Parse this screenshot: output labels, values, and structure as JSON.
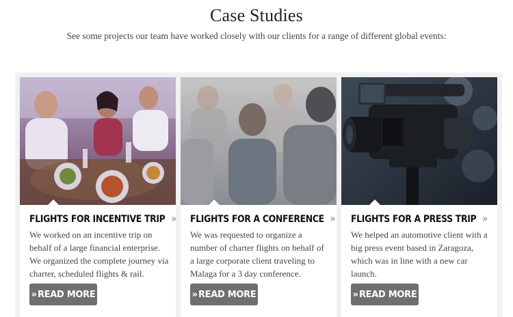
{
  "header": {
    "title": "Case Studies",
    "subtitle": "See some projects our team have worked closely with our clients for a range of different global events:"
  },
  "cards": [
    {
      "image_icon": "dinner-party-photo",
      "title": "FLIGHTS FOR INCENTIVE TRIP",
      "chevron": "»",
      "text": "We worked on an incentive trip on behalf of a large financial enterprise. We organized the complete journey via charter, scheduled flights & rail.",
      "button_icon": "»",
      "button_label": "READ MORE"
    },
    {
      "image_icon": "conference-audience-photo",
      "title": "FLIGHTS FOR A CONFERENCE",
      "chevron": "»",
      "text": "We was requested to organize a number of charter flights on behalf of a large corporate client traveling to Malaga for a 3 day conference.",
      "button_icon": "»",
      "button_label": "READ MORE"
    },
    {
      "image_icon": "press-video-camera-photo",
      "title": "FLIGHTS FOR A PRESS TRIP",
      "chevron": "»",
      "text": "We helped an automotive client with a big press event based in Zaragoza, which was in line with a new car launch.",
      "button_icon": "»",
      "button_label": "READ MORE"
    }
  ],
  "colors": {
    "button_bg": "#6f6f6f",
    "band_bg": "#f1f1f1",
    "title_text": "#111111"
  }
}
